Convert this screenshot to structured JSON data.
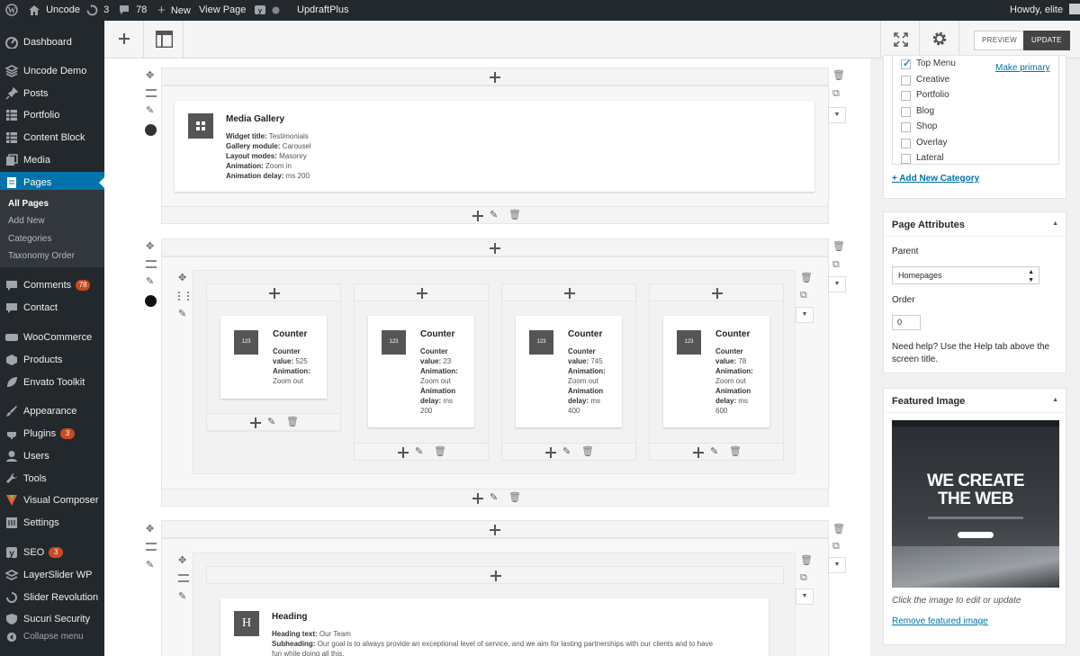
{
  "adminbar": {
    "site_name": "Uncode",
    "updates_count": "3",
    "comments_count": "78",
    "new_label": "New",
    "view_page_label": "View Page",
    "plugin_label": "UpdraftPlus",
    "howdy": "Howdy, elite"
  },
  "sidebar": {
    "items": [
      {
        "label": "Dashboard",
        "icon": "dashboard-icon"
      },
      {
        "label": "Uncode Demo",
        "icon": "layers-icon"
      },
      {
        "label": "Posts",
        "icon": "pin-icon"
      },
      {
        "label": "Portfolio",
        "icon": "grid-icon"
      },
      {
        "label": "Content Block",
        "icon": "grid-icon"
      },
      {
        "label": "Media",
        "icon": "media-icon"
      },
      {
        "label": "Pages",
        "icon": "page-icon"
      },
      {
        "label": "Comments",
        "icon": "comment-icon",
        "badge": "78"
      },
      {
        "label": "Contact",
        "icon": "comment-icon"
      },
      {
        "label": "WooCommerce",
        "icon": "woo-icon"
      },
      {
        "label": "Products",
        "icon": "box-icon"
      },
      {
        "label": "Envato Toolkit",
        "icon": "leaf-icon"
      },
      {
        "label": "Appearance",
        "icon": "brush-icon"
      },
      {
        "label": "Plugins",
        "icon": "plug-icon",
        "badge": "3"
      },
      {
        "label": "Users",
        "icon": "user-icon"
      },
      {
        "label": "Tools",
        "icon": "wrench-icon"
      },
      {
        "label": "Visual Composer",
        "icon": "vc-icon"
      },
      {
        "label": "Settings",
        "icon": "settings-icon"
      },
      {
        "label": "SEO",
        "icon": "seo-icon",
        "badge": "3"
      },
      {
        "label": "LayerSlider WP",
        "icon": "layer-icon"
      },
      {
        "label": "Slider Revolution",
        "icon": "refresh-icon"
      },
      {
        "label": "Sucuri Security",
        "icon": "shield-icon"
      }
    ],
    "submenu": [
      "All Pages",
      "Add New",
      "Categories",
      "Taxonomy Order"
    ],
    "collapse_label": "Collapse menu"
  },
  "toolbar": {
    "preview_label": "PREVIEW",
    "update_label": "UPDATE"
  },
  "editor": {
    "media_gallery": {
      "title": "Media Gallery",
      "params": [
        {
          "k": "Widget title:",
          "v": "Testimonials"
        },
        {
          "k": "Gallery module:",
          "v": "Carousel"
        },
        {
          "k": "Layout modes:",
          "v": "Masonry"
        },
        {
          "k": "Animation:",
          "v": "Zoom in"
        },
        {
          "k": "Animation delay:",
          "v": "ms 200"
        }
      ]
    },
    "counter_icon_text": "123",
    "counters": [
      {
        "title": "Counter",
        "lines": [
          "<b>Counter</b>",
          "<b>value:</b> 525",
          "<b>Animation:</b>",
          "Zoom out"
        ]
      },
      {
        "title": "Counter",
        "lines": [
          "<b>Counter</b>",
          "<b>value:</b> 23",
          "<b>Animation:</b>",
          "Zoom out",
          "<b>Animation</b>",
          "<b>delay:</b> ms",
          "200"
        ]
      },
      {
        "title": "Counter",
        "lines": [
          "<b>Counter</b>",
          "<b>value:</b> 745",
          "<b>Animation:</b>",
          "Zoom out",
          "<b>Animation</b>",
          "<b>delay:</b> ms",
          "400"
        ]
      },
      {
        "title": "Counter",
        "lines": [
          "<b>Counter</b>",
          "<b>value:</b> 78",
          "<b>Animation:</b>",
          "Zoom out",
          "<b>Animation</b>",
          "<b>delay:</b> ms",
          "600"
        ]
      }
    ],
    "heading": {
      "icon_letter": "H",
      "title": "Heading",
      "text_key": "Heading text:",
      "text_val": "Our Team",
      "sub_key": "Subheading:",
      "sub_val": "Our goal is to always provide an exceptional level of service, and we aim for lasting partnerships with our clients and to have",
      "sub_val2": "fun while doing all this."
    }
  },
  "categories": {
    "items": [
      {
        "label": "Top Menu",
        "checked": true
      },
      {
        "label": "Creative",
        "checked": false
      },
      {
        "label": "Portfolio",
        "checked": false
      },
      {
        "label": "Blog",
        "checked": false
      },
      {
        "label": "Shop",
        "checked": false
      },
      {
        "label": "Overlay",
        "checked": false
      },
      {
        "label": "Lateral",
        "checked": false
      }
    ],
    "make_primary": "Make primary",
    "add_new": "+ Add New Category"
  },
  "page_attributes": {
    "title": "Page Attributes",
    "parent_label": "Parent",
    "parent_value": "Homepages",
    "order_label": "Order",
    "order_value": "0",
    "help": "Need help? Use the Help tab above the",
    "help2": "screen title."
  },
  "featured_image": {
    "title": "Featured Image",
    "hero_line1": "WE CREATE",
    "hero_line2": "THE WEB",
    "caption": "Click the image to edit or update",
    "remove_label": "Remove featured image"
  },
  "colors": {
    "accent": "#0073aa",
    "sidebar": "#23282d",
    "badge": "#ca4a1f"
  }
}
